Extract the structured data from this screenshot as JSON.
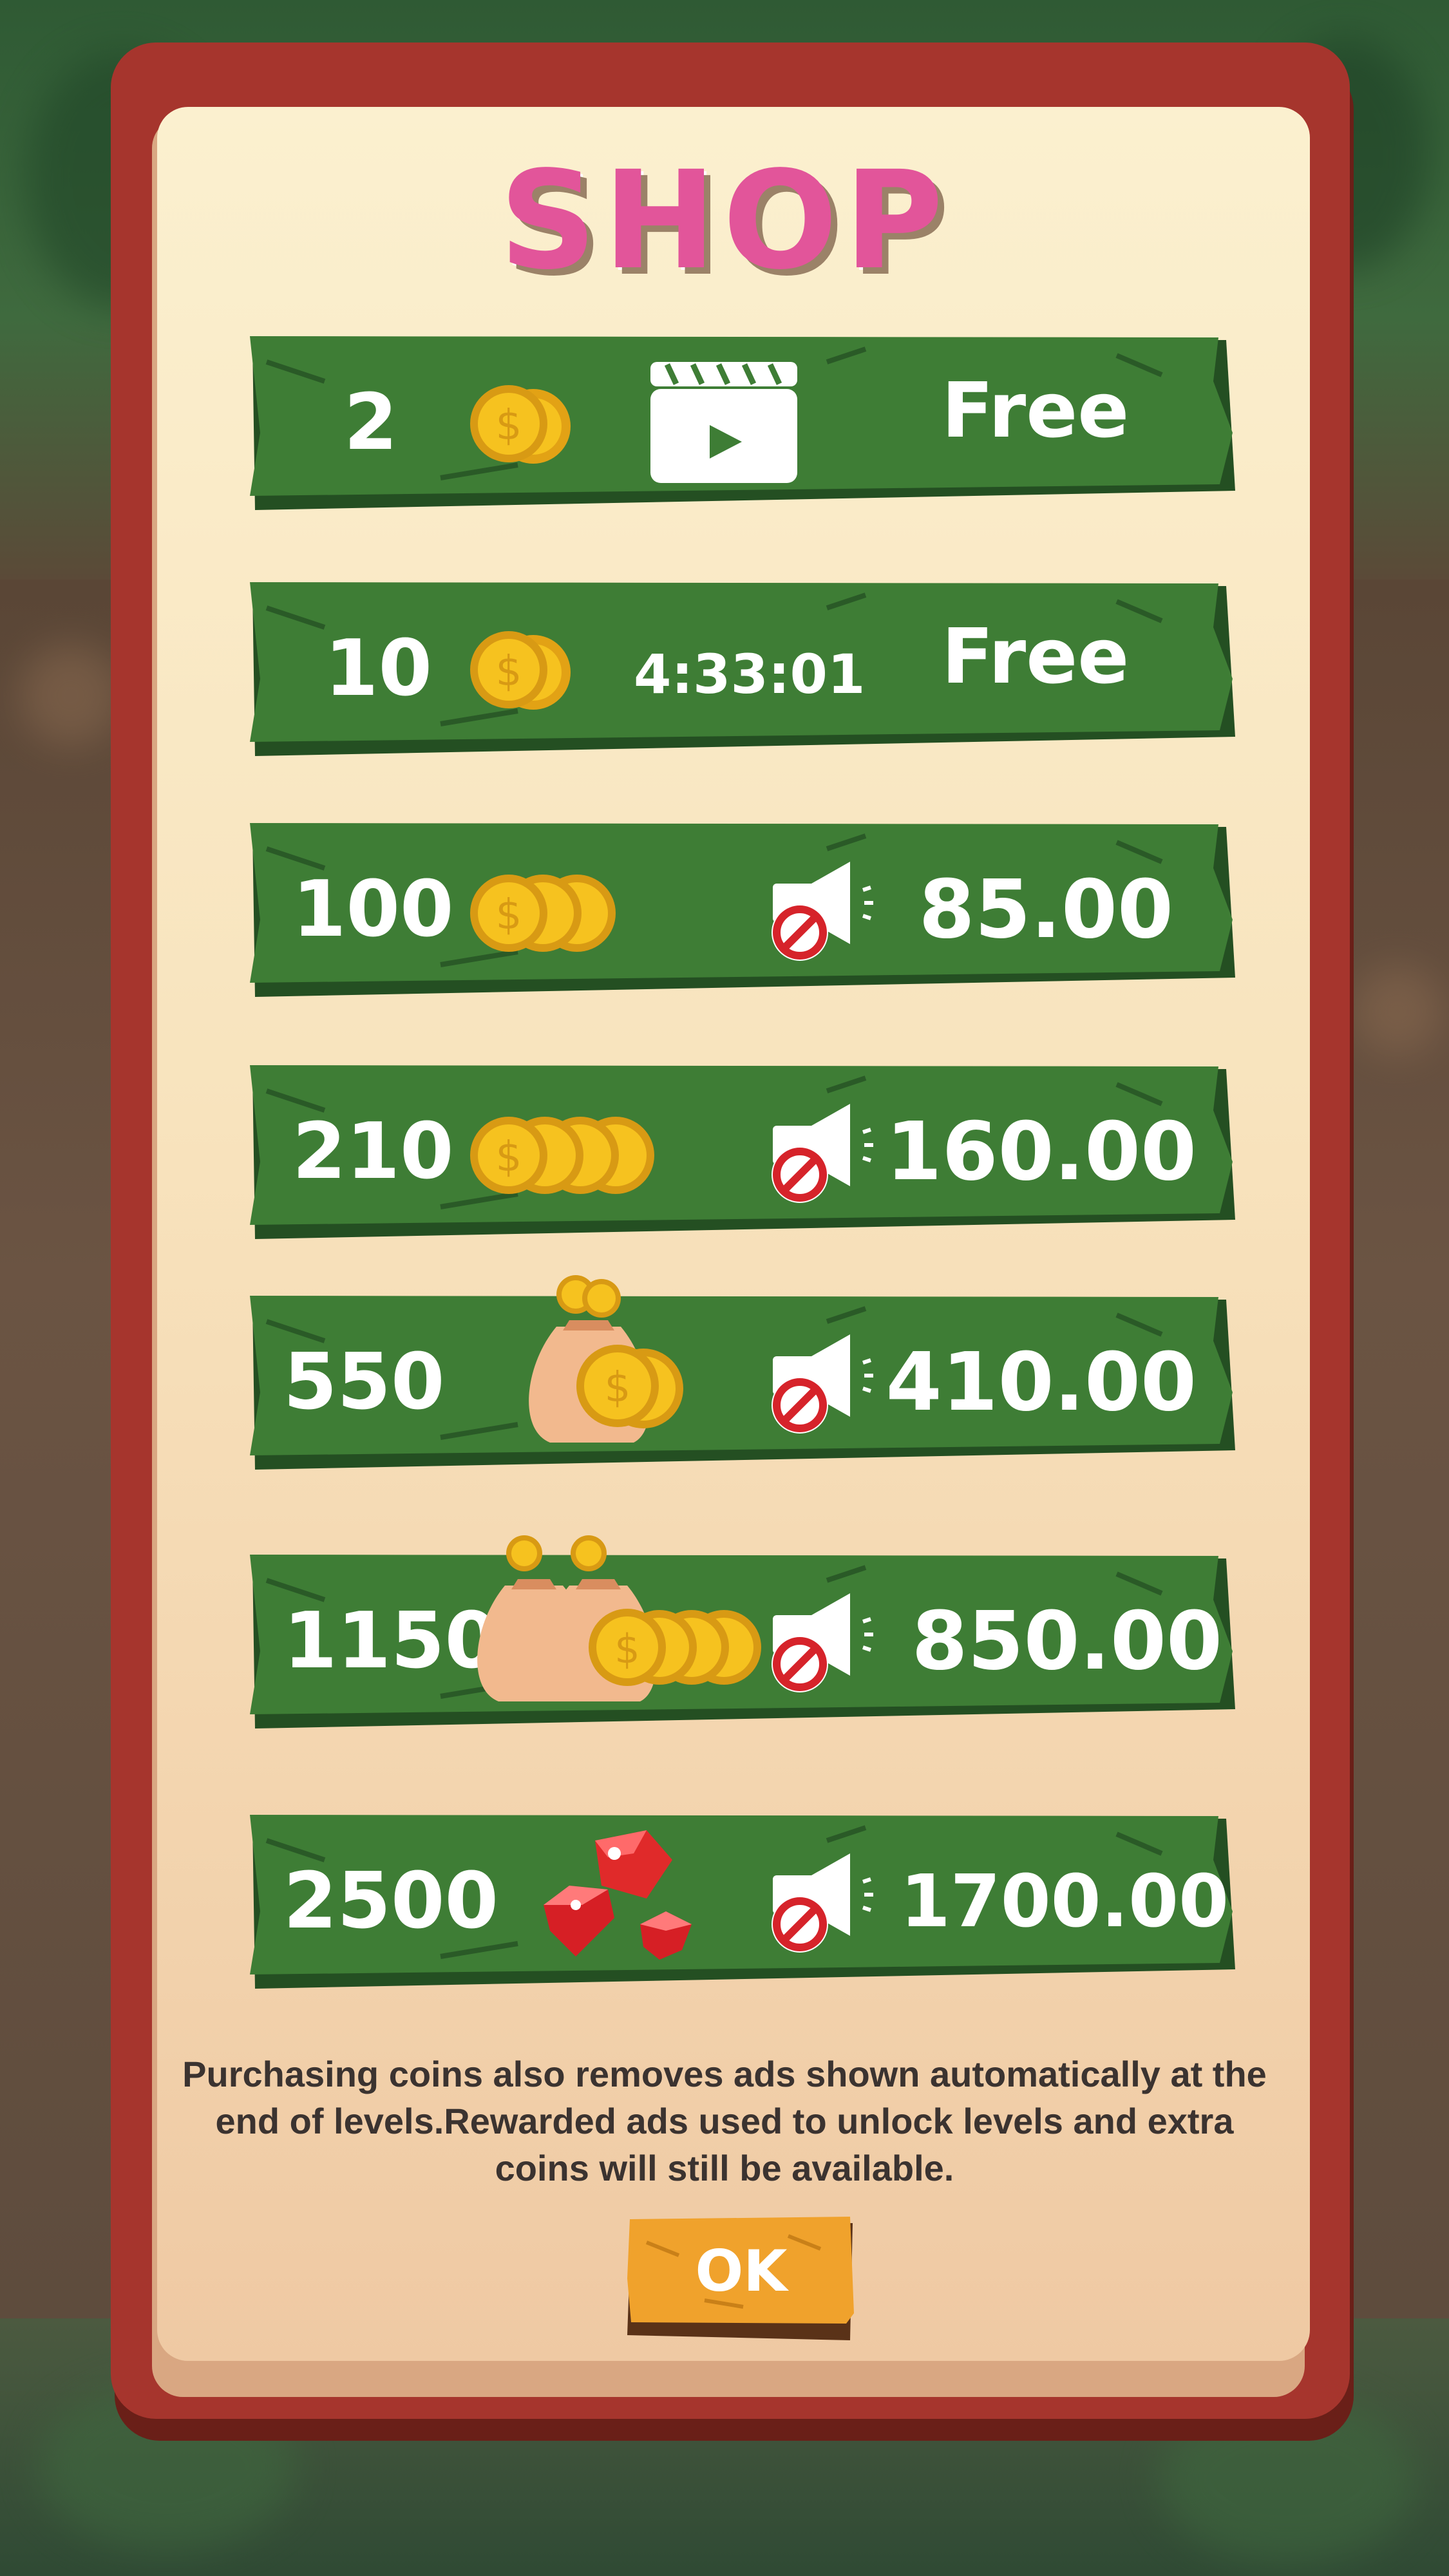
{
  "shop": {
    "title": "SHOP",
    "rows": [
      {
        "amount": "2",
        "price": "Free",
        "extra": "video",
        "coin_icon": "coin-pair-icon"
      },
      {
        "amount": "10",
        "price": "Free",
        "extra": "timer",
        "timer": "4:33:01",
        "coin_icon": "coin-pair-icon"
      },
      {
        "amount": "100",
        "price": "85.00",
        "extra": "no-ads",
        "coin_icon": "coin-stack-3-icon"
      },
      {
        "amount": "210",
        "price": "160.00",
        "extra": "no-ads",
        "coin_icon": "coin-stack-4-icon"
      },
      {
        "amount": "550",
        "price": "410.00",
        "extra": "no-ads",
        "coin_icon": "coin-bag-icon"
      },
      {
        "amount": "1150",
        "price": "850.00",
        "extra": "no-ads",
        "coin_icon": "coin-bags-icon"
      },
      {
        "amount": "2500",
        "price": "1700.00",
        "extra": "no-ads",
        "coin_icon": "ruby-gems-icon"
      }
    ],
    "note": "Purchasing coins also removes ads shown automatically at the end of levels.Rewarded ads used to unlock levels and extra coins will still be available.",
    "ok_label": "OK"
  },
  "colors": {
    "title": "#e2559a",
    "plank": "#3e7d35",
    "plank_shadow": "#244f22",
    "panel_frame": "#a6352d",
    "ok_button": "#f0a22c",
    "coin": "#f6c21f",
    "no_ads_red": "#d6232a"
  }
}
